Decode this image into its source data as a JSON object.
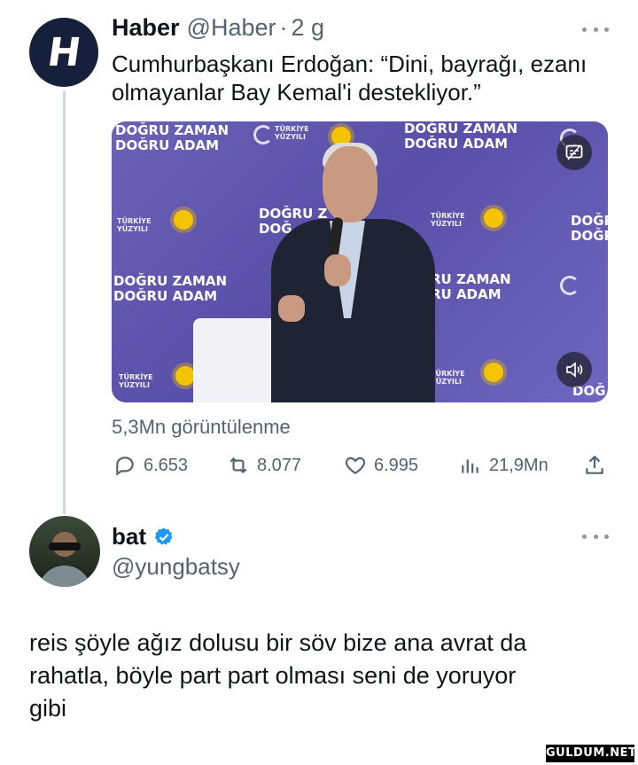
{
  "tweet1": {
    "avatar_letter": "H",
    "name": "Haber",
    "handle": "@Haber",
    "separator": "·",
    "time": "2 g",
    "text_line1": "Cumhurbaşkanı Erdoğan: “Dini, bayrağı, ezanı",
    "text_line2": "olmayanlar Bay Kemal'i destekliyor.”",
    "media": {
      "banner_1a": "DOĞRU ZAMAN",
      "banner_1b": "DOĞRU ADAM",
      "banner_2a": "DOĞRU ZAMAN",
      "banner_2b": "DOĞRU ADAM",
      "banner_3a": "DOĞRU ZAMAN",
      "banner_3b": "DOĞRU ADAM",
      "banner_4a": "RU ZAMAN",
      "banner_4b": "RU ADAM",
      "banner_5a": "DOĞRU Z",
      "banner_5b": "DOĞ",
      "banner_6a": "DOĞR",
      "banner_6b": "DOĞR",
      "banner_7": "DOĞ",
      "small_1": "TÜRKİYE YÜZYILI",
      "small_2": "TÜRKİYE YÜZYILI",
      "small_3": "TÜRKİYE YÜZYILI",
      "small_4": "TÜRKİYE YÜZYILI",
      "small_5": "TÜRKİYE YÜZYILI",
      "caption_icon": "captions-icon",
      "volume_icon": "volume-icon"
    },
    "views": "5,3Mn görüntülenme",
    "replies": "6.653",
    "retweets": "8.077",
    "likes": "6.995",
    "analytics": "21,9Mn"
  },
  "tweet2": {
    "name": "bat",
    "handle": "@yungbatsy",
    "text_line1": "reis şöyle ağız dolusu bir söv bize ana avrat da",
    "text_line2": "rahatla, böyle part part olması seni de yoruyor",
    "text_line3": "gibi"
  },
  "watermark": "GULDUM.NET",
  "colors": {
    "secondary_text": "#536471",
    "verified_blue": "#1d9bf0",
    "thread_line": "#cfd9de"
  }
}
